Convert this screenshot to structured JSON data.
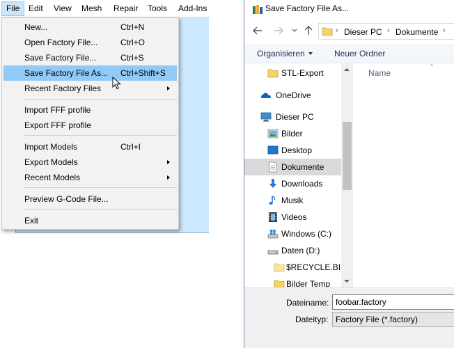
{
  "menubar": {
    "items": [
      "File",
      "Edit",
      "View",
      "Mesh",
      "Repair",
      "Tools",
      "Add-Ins"
    ]
  },
  "file_menu": {
    "items": [
      {
        "label": "New...",
        "shortcut": "Ctrl+N"
      },
      {
        "label": "Open Factory File...",
        "shortcut": "Ctrl+O"
      },
      {
        "label": "Save Factory File...",
        "shortcut": "Ctrl+S"
      },
      {
        "label": "Save Factory File As...",
        "shortcut": "Ctrl+Shift+S"
      },
      {
        "label": "Recent Factory Files",
        "shortcut": ""
      },
      {
        "label": "Import FFF profile",
        "shortcut": ""
      },
      {
        "label": "Export FFF profile",
        "shortcut": ""
      },
      {
        "label": "Import Models",
        "shortcut": "Ctrl+I"
      },
      {
        "label": "Export Models",
        "shortcut": ""
      },
      {
        "label": "Recent Models",
        "shortcut": ""
      },
      {
        "label": "Preview G-Code File...",
        "shortcut": ""
      },
      {
        "label": "Exit",
        "shortcut": ""
      }
    ]
  },
  "dialog": {
    "title": "Save Factory File As...",
    "breadcrumb": [
      "Dieser PC",
      "Dokumente"
    ],
    "commands": {
      "organize": "Organisieren",
      "new_folder": "Neuer Ordner"
    },
    "nav_items": [
      {
        "label": "STL-Export",
        "icon": "folder-icon"
      },
      {
        "label": "OneDrive",
        "icon": "onedrive-icon"
      },
      {
        "label": "Dieser PC",
        "icon": "computer-icon"
      },
      {
        "label": "Bilder",
        "icon": "pictures-icon"
      },
      {
        "label": "Desktop",
        "icon": "desktop-icon"
      },
      {
        "label": "Dokumente",
        "icon": "documents-icon"
      },
      {
        "label": "Downloads",
        "icon": "downloads-icon"
      },
      {
        "label": "Musik",
        "icon": "music-icon"
      },
      {
        "label": "Videos",
        "icon": "videos-icon"
      },
      {
        "label": "Windows (C:)",
        "icon": "windows-drive-icon"
      },
      {
        "label": "Daten (D:)",
        "icon": "drive-icon"
      },
      {
        "label": "$RECYCLE.BIN",
        "icon": "folder-icon"
      },
      {
        "label": "Bilder Temp",
        "icon": "folder-icon"
      }
    ],
    "column_header": "Name",
    "filename_label": "Dateiname:",
    "filename_value": "foobar.factory",
    "filetype_label": "Dateityp:",
    "filetype_value": "Factory File (*.factory)"
  },
  "colors": {
    "menu_highlight": "#91c9f7",
    "app_canvas": "#cce8ff",
    "command_bar": "#f3f6fb",
    "nav_selected": "#d9d9d9"
  }
}
